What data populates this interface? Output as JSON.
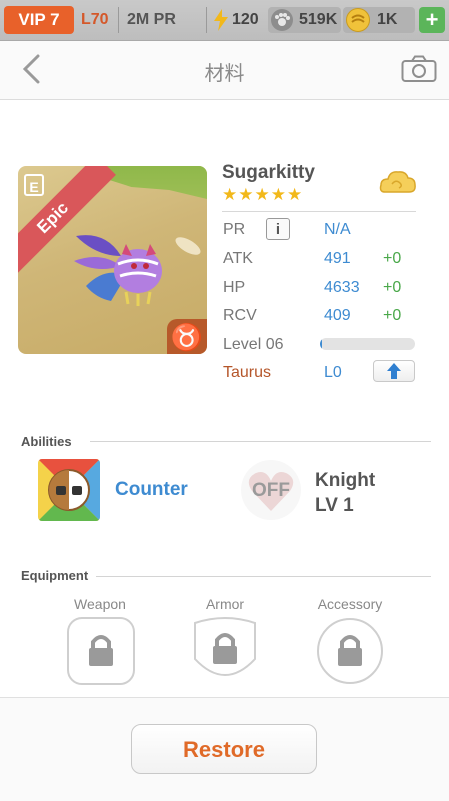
{
  "status_bar": {
    "vip": "VIP 7",
    "level": "L70",
    "pr": "2M PR",
    "energy": "120",
    "paw": "519K",
    "coins": "1K",
    "plus": "+"
  },
  "header": {
    "title": "材料",
    "back_icon": "chevron-left-icon",
    "camera_icon": "camera-icon"
  },
  "monster": {
    "rarity": "Epic",
    "name": "Sugarkitty",
    "stars": "★★★★★",
    "zodiac_symbol": "♉",
    "stats": {
      "pr_label": "PR",
      "pr_info": "i",
      "pr_value": "N/A",
      "atk_label": "ATK",
      "atk_value": "491",
      "atk_bonus": "+0",
      "hp_label": "HP",
      "hp_value": "4633",
      "hp_bonus": "+0",
      "rcv_label": "RCV",
      "rcv_value": "409",
      "rcv_bonus": "+0",
      "level_label": "Level 06",
      "level_progress": 0.02,
      "zodiac_label": "Taurus",
      "zodiac_level": "L0"
    }
  },
  "abilities": {
    "heading": "Abilities",
    "skill_name": "Counter",
    "leader_state": "OFF",
    "leader_name": "Knight",
    "leader_level": "LV 1"
  },
  "equipment": {
    "heading": "Equipment",
    "slots": [
      "Weapon",
      "Armor",
      "Accessory"
    ]
  },
  "footer": {
    "restore_label": "Restore"
  },
  "colors": {
    "accent_orange": "#e06a28",
    "value_blue": "#3e8bd1",
    "bonus_green": "#4aa84a",
    "epic_red": "#d9575a"
  }
}
